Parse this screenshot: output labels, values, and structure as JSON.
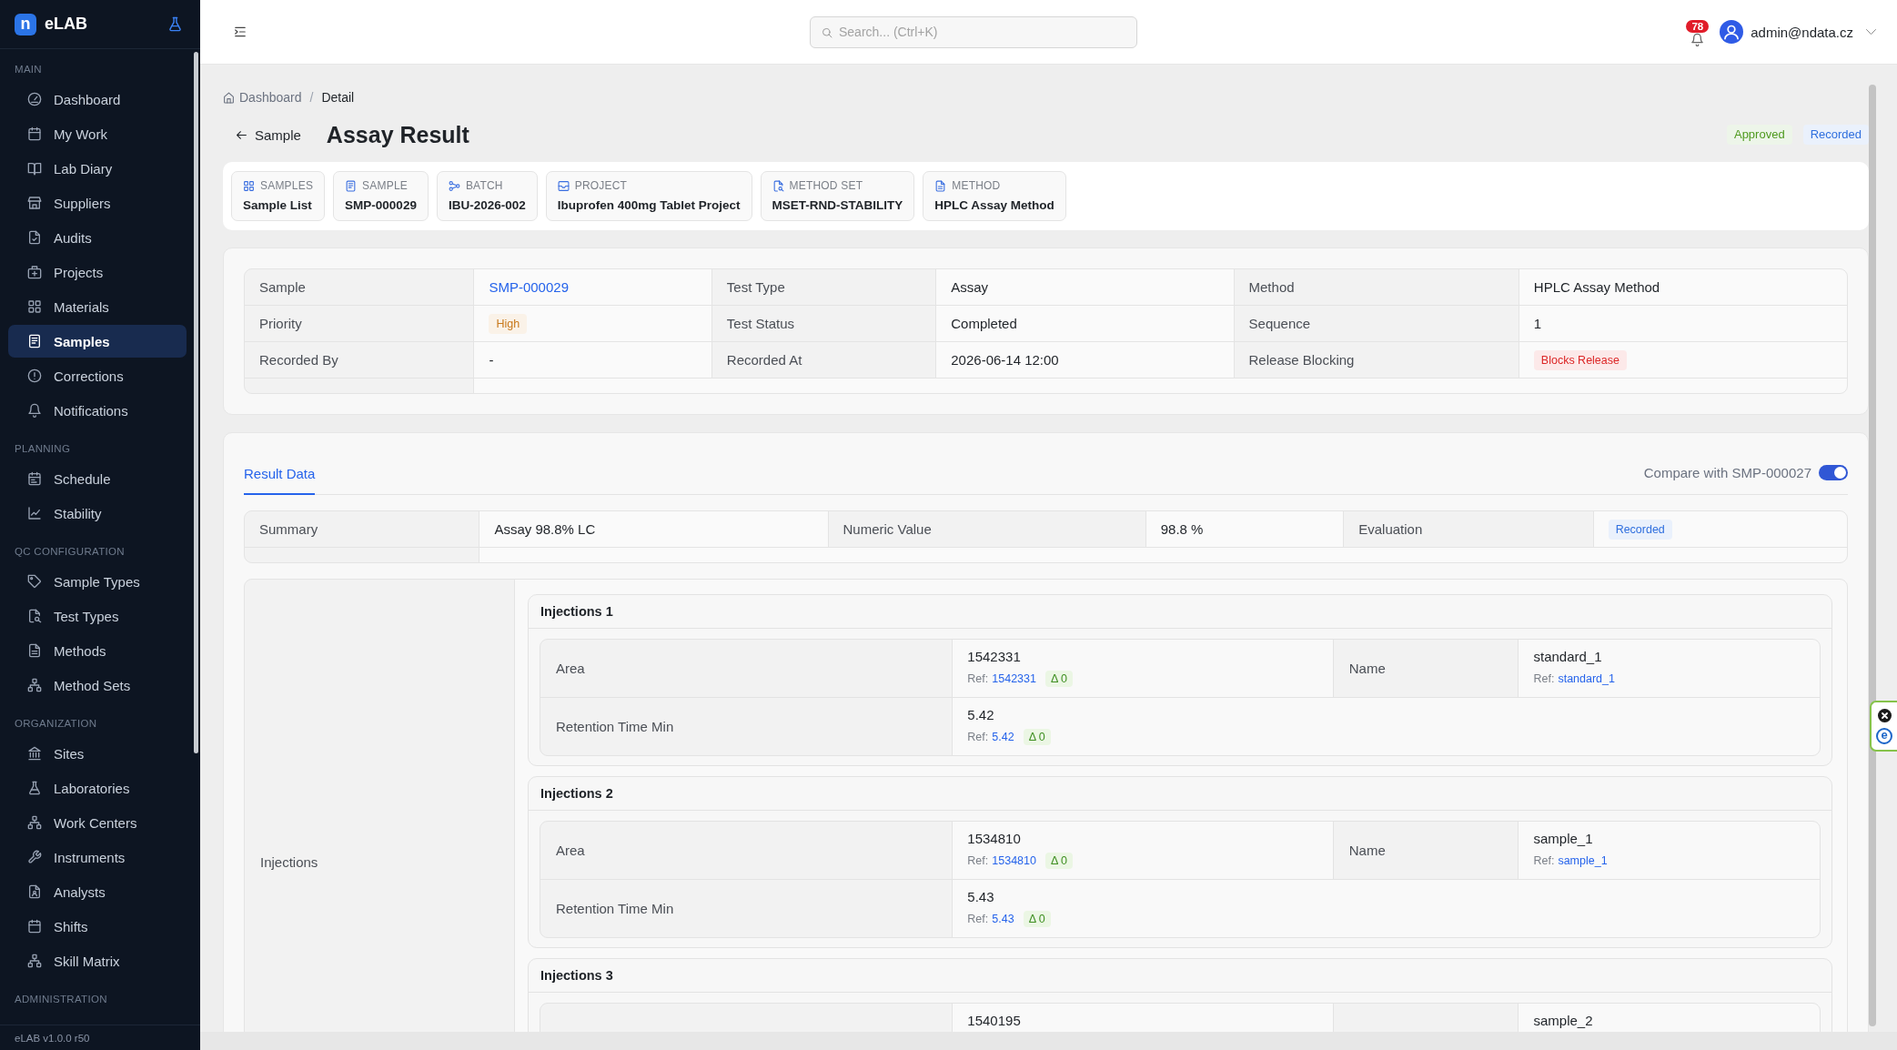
{
  "sidebar": {
    "brand": {
      "mark": "n",
      "name": "eLAB"
    },
    "sections": [
      {
        "title": "MAIN",
        "items": [
          {
            "label": "Dashboard",
            "selected": false
          },
          {
            "label": "My Work",
            "selected": false
          },
          {
            "label": "Lab Diary",
            "selected": false
          },
          {
            "label": "Suppliers",
            "selected": false
          },
          {
            "label": "Audits",
            "selected": false
          },
          {
            "label": "Projects",
            "selected": false
          },
          {
            "label": "Materials",
            "selected": false
          },
          {
            "label": "Samples",
            "selected": true
          },
          {
            "label": "Corrections",
            "selected": false
          },
          {
            "label": "Notifications",
            "selected": false
          }
        ]
      },
      {
        "title": "PLANNING",
        "items": [
          {
            "label": "Schedule",
            "selected": false
          },
          {
            "label": "Stability",
            "selected": false
          }
        ]
      },
      {
        "title": "QC CONFIGURATION",
        "items": [
          {
            "label": "Sample Types",
            "selected": false
          },
          {
            "label": "Test Types",
            "selected": false
          },
          {
            "label": "Methods",
            "selected": false
          },
          {
            "label": "Method Sets",
            "selected": false
          }
        ]
      },
      {
        "title": "ORGANIZATION",
        "items": [
          {
            "label": "Sites",
            "selected": false
          },
          {
            "label": "Laboratories",
            "selected": false
          },
          {
            "label": "Work Centers",
            "selected": false
          },
          {
            "label": "Instruments",
            "selected": false
          },
          {
            "label": "Analysts",
            "selected": false
          },
          {
            "label": "Shifts",
            "selected": false
          },
          {
            "label": "Skill Matrix",
            "selected": false
          }
        ]
      },
      {
        "title": "ADMINISTRATION"
      }
    ],
    "version": "eLAB v1.0.0 r50"
  },
  "topbar": {
    "search": {
      "placeholder": "Search... (Ctrl+K)"
    },
    "notification_count": "78",
    "user": {
      "email": "admin@ndata.cz"
    }
  },
  "breadcrumb": {
    "items": [
      {
        "label": "Dashboard",
        "kind": "home"
      },
      {
        "label": "Detail",
        "kind": "current"
      }
    ],
    "separator": "/"
  },
  "header": {
    "back_label": "Sample",
    "title": "Assay Result",
    "badges": [
      {
        "label": "Approved",
        "color": "#4f9a1f"
      },
      {
        "label": "Recorded",
        "color": "#2f6fde"
      }
    ]
  },
  "related": [
    {
      "label": "SAMPLES",
      "value": "Sample List"
    },
    {
      "label": "SAMPLE",
      "value": "SMP-000029"
    },
    {
      "label": "BATCH",
      "value": "IBU-2026-002"
    },
    {
      "label": "PROJECT",
      "value": "Ibuprofen 400mg Tablet Project"
    },
    {
      "label": "METHOD SET",
      "value": "MSET-RND-STABILITY"
    },
    {
      "label": "METHOD",
      "value": "HPLC Assay Method"
    }
  ],
  "details": {
    "rows": [
      [
        {
          "label": "Sample",
          "value": "SMP-000029",
          "kind": "link"
        },
        {
          "label": "Test Type",
          "value": "Assay",
          "kind": "text"
        },
        {
          "label": "Method",
          "value": "HPLC Assay Method",
          "kind": "text"
        }
      ],
      [
        {
          "label": "Priority",
          "value": "High",
          "kind": "badge",
          "color": "#c8781a"
        },
        {
          "label": "Test Status",
          "value": "Completed",
          "kind": "text"
        },
        {
          "label": "Sequence",
          "value": "1",
          "kind": "text"
        }
      ],
      [
        {
          "label": "Recorded By",
          "value": "-",
          "kind": "text"
        },
        {
          "label": "Recorded At",
          "value": "2026-06-14 12:00",
          "kind": "text"
        },
        {
          "label": "Release Blocking",
          "value": "Blocks Release",
          "kind": "badge",
          "color": "#dc2626"
        }
      ]
    ]
  },
  "result": {
    "tabs": [
      {
        "label": "Result Data",
        "selected": true
      }
    ],
    "compare": {
      "label": "Compare with SMP-000027",
      "on": true
    },
    "summary": [
      {
        "label": "Summary",
        "value": "Assay 98.8% LC",
        "kind": "text"
      },
      {
        "label": "Numeric Value",
        "value": "98.8 %",
        "kind": "text"
      },
      {
        "label": "Evaluation",
        "value": "Recorded",
        "kind": "badge",
        "color": "#2f6fde"
      }
    ],
    "injections": {
      "label": "Injections",
      "groups": [
        {
          "title": "Injections 1",
          "rows": [
            [
              {
                "label": "Area",
                "value": "1542331",
                "ref_label": "Ref:",
                "ref": "1542331",
                "delta": "Δ 0"
              },
              {
                "label": "Name",
                "value": "standard_1",
                "ref_label": "Ref:",
                "ref": "standard_1"
              }
            ],
            [
              {
                "label": "Retention Time Min",
                "value": "5.42",
                "ref_label": "Ref:",
                "ref": "5.42",
                "delta": "Δ 0"
              }
            ]
          ]
        },
        {
          "title": "Injections 2",
          "rows": [
            [
              {
                "label": "Area",
                "value": "1534810",
                "ref_label": "Ref:",
                "ref": "1534810",
                "delta": "Δ 0"
              },
              {
                "label": "Name",
                "value": "sample_1",
                "ref_label": "Ref:",
                "ref": "sample_1"
              }
            ],
            [
              {
                "label": "Retention Time Min",
                "value": "5.43",
                "ref_label": "Ref:",
                "ref": "5.43",
                "delta": "Δ 0"
              }
            ]
          ]
        },
        {
          "title": "Injections 3",
          "rows": [
            [
              {
                "value": "1540195"
              },
              {
                "value": "sample_2"
              }
            ]
          ]
        }
      ]
    }
  },
  "extension_widget": {
    "logo": "e"
  }
}
